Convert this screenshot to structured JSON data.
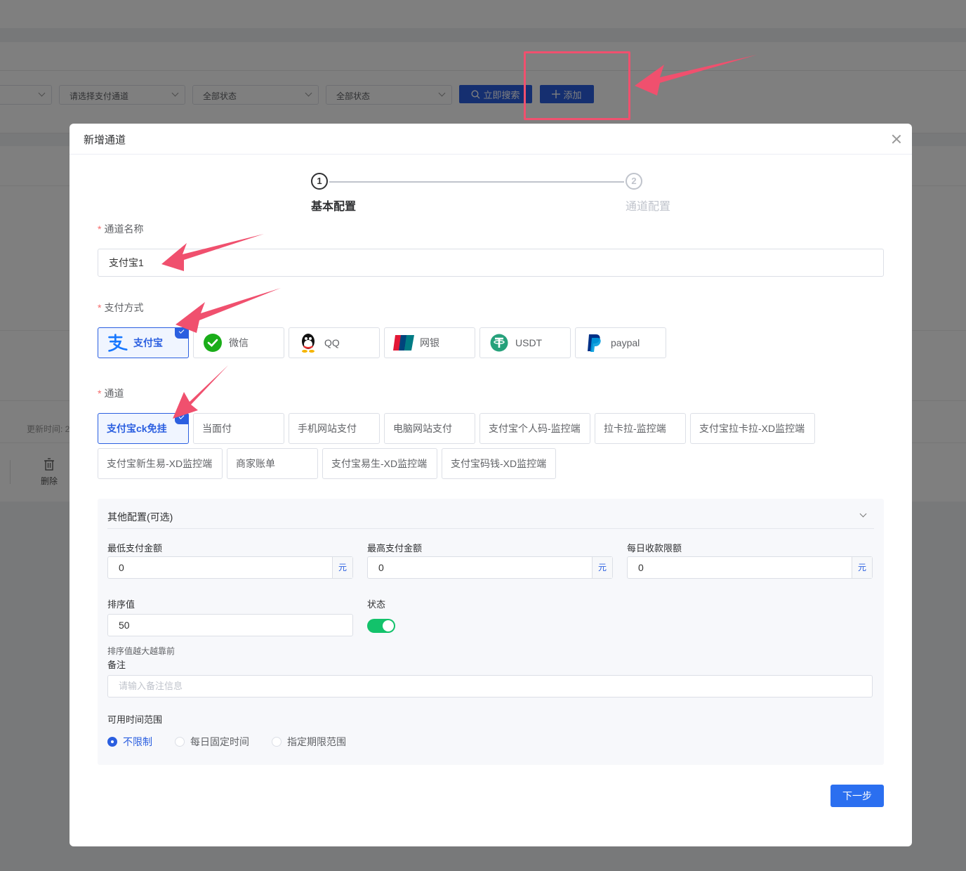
{
  "background": {
    "filters": {
      "channel_placeholder": "请选择支付通道",
      "status1": "全部状态",
      "status2": "全部状态"
    },
    "search_label": "立即搜索",
    "add_label": "添加",
    "update_time_label": "更新时间: 2",
    "delete_label": "删除"
  },
  "modal": {
    "title": "新增通道",
    "steps": [
      {
        "num": "1",
        "label": "基本配置"
      },
      {
        "num": "2",
        "label": "通道配置"
      }
    ],
    "name_label": "通道名称",
    "name_value": "支付宝1",
    "pay_method_label": "支付方式",
    "pay_methods": [
      {
        "label": "支付宝",
        "icon": "alipay-icon",
        "selected": true
      },
      {
        "label": "微信",
        "icon": "wechat-icon",
        "selected": false
      },
      {
        "label": "QQ",
        "icon": "qq-icon",
        "selected": false
      },
      {
        "label": "网银",
        "icon": "unionpay-icon",
        "selected": false
      },
      {
        "label": "USDT",
        "icon": "usdt-icon",
        "selected": false
      },
      {
        "label": "paypal",
        "icon": "paypal-icon",
        "selected": false
      }
    ],
    "channel_label": "通道",
    "channels": [
      "支付宝ck免挂",
      "当面付",
      "手机网站支付",
      "电脑网站支付",
      "支付宝个人码-监控端",
      "拉卡拉-监控端",
      "支付宝拉卡拉-XD监控端",
      "支付宝新生易-XD监控端",
      "商家账单",
      "支付宝易生-XD监控端",
      "支付宝码钱-XD监控端"
    ],
    "other": {
      "title": "其他配置(可选)",
      "min_amount_label": "最低支付金额",
      "min_amount": "0",
      "max_amount_label": "最高支付金额",
      "max_amount": "0",
      "daily_limit_label": "每日收款限额",
      "daily_limit": "0",
      "unit": "元",
      "sort_label": "排序值",
      "sort_value": "50",
      "sort_hint": "排序值越大越靠前",
      "status_label": "状态",
      "status_on": true,
      "remark_label": "备注",
      "remark_placeholder": "请输入备注信息",
      "time_range_label": "可用时间范围",
      "time_options": [
        "不限制",
        "每日固定时间",
        "指定期限范围"
      ]
    },
    "next_label": "下一步"
  },
  "colors": {
    "primary": "#2b5fe0",
    "annotation": "#f0506e",
    "toggle_on": "#13c26b"
  }
}
